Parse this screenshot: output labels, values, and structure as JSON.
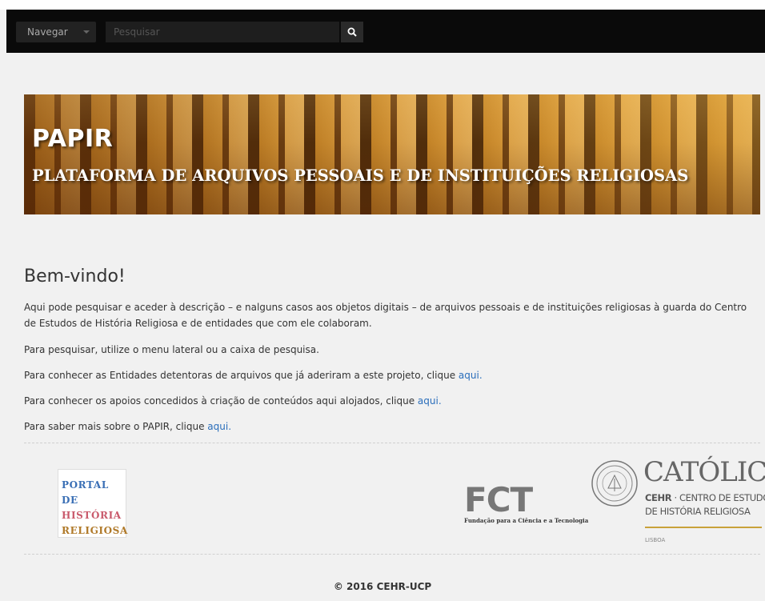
{
  "navbar": {
    "browse_label": "Navegar",
    "search_placeholder": "Pesquisar"
  },
  "banner": {
    "title": "PAPIR",
    "subtitle": "PLATAFORMA DE ARQUIVOS PESSOAIS E DE INSTITUIÇÕES RELIGIOSAS"
  },
  "content": {
    "heading": "Bem-vindo!",
    "intro": "Aqui pode pesquisar e aceder à descrição – e nalguns casos aos objetos digitais – de arquivos pessoais e de instituições religiosas à guarda do Centro de Estudos de História Religiosa e de entidades que com ele colaboram.",
    "search_hint": "Para pesquisar, utilize o menu lateral ou a caixa de pesquisa.",
    "entities_text": "Para conhecer as Entidades detentoras de arquivos que já aderiram a este projeto, clique ",
    "entities_link": "aqui.",
    "support_text": "Para conhecer os apoios concedidos à criação de conteúdos aqui alojados, clique ",
    "support_link": "aqui.",
    "about_text": "Para saber mais sobre o PAPIR, clique ",
    "about_link": "aqui."
  },
  "logos": {
    "portal": [
      "PORTAL DE",
      "HISTÓRIA",
      "RELIGIOSA"
    ],
    "fct": "FCT",
    "fct_sub": "Fundação para a Ciência e a Tecnologia",
    "catolica": "CATÓLICA",
    "cehr_abbr": "CEHR",
    "cehr_line1": " · CENTRO DE ESTUDOS",
    "cehr_line2": "DE HISTÓRIA RELIGIOSA",
    "lisboa": "LISBOA"
  },
  "footer": {
    "copyright": "© 2016 CEHR-UCP"
  },
  "colors": {
    "link": "#2a6ebb",
    "navbar": "#0a0a0a",
    "background": "#f1f1f1"
  }
}
